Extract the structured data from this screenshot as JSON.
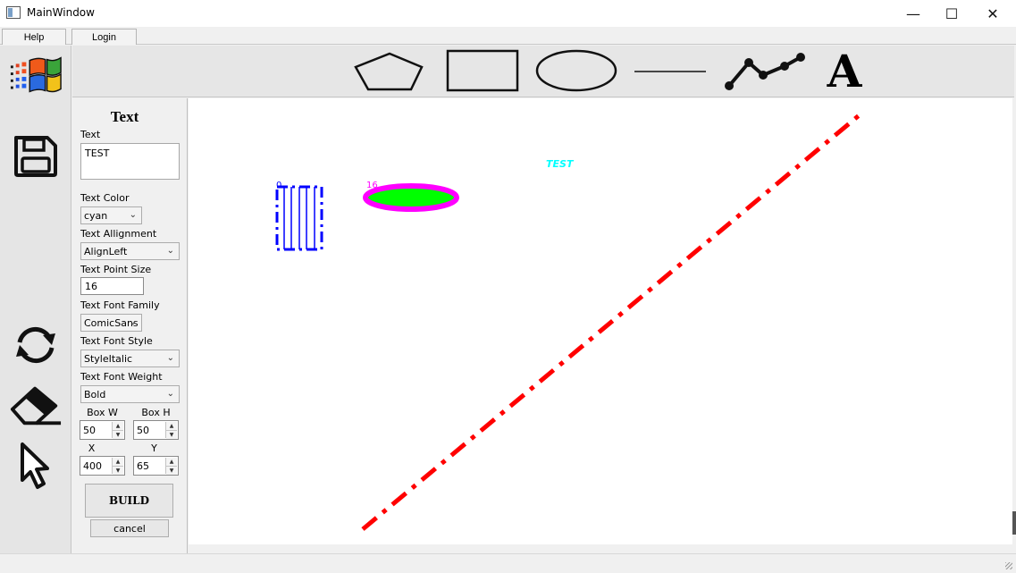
{
  "window": {
    "title": "MainWindow",
    "minimize_glyph": "—",
    "maximize_glyph": "☐",
    "close_glyph": "✕"
  },
  "menu": {
    "help": "Help",
    "login": "Login"
  },
  "left_tools": [
    {
      "icon": "windows-logo-icon"
    },
    {
      "icon": "save-icon"
    },
    {
      "icon": "refresh-icon"
    },
    {
      "icon": "eraser-icon"
    },
    {
      "icon": "pointer-icon"
    }
  ],
  "shape_tools": [
    {
      "icon": "pentagon-icon"
    },
    {
      "icon": "rectangle-icon"
    },
    {
      "icon": "ellipse-icon"
    },
    {
      "icon": "line-icon"
    },
    {
      "icon": "polyline-icon"
    },
    {
      "icon": "text-tool-icon",
      "glyph": "A"
    }
  ],
  "panel": {
    "title": "Text",
    "text_label": "Text",
    "text_value": "TEST",
    "text_color_label": "Text Color",
    "text_color_value": "cyan",
    "alignment_label": "Text Allignment",
    "alignment_value": "AlignLeft",
    "point_size_label": "Text Point Size",
    "point_size_value": "16",
    "font_family_label": "Text Font Family",
    "font_family_value": "ComicSans",
    "font_style_label": "Text Font Style",
    "font_style_value": "StyleItalic",
    "font_weight_label": "Text Font Weight",
    "font_weight_value": "Bold",
    "box_w_label": "Box W",
    "box_w_value": "50",
    "box_h_label": "Box H",
    "box_h_value": "50",
    "x_label": "X",
    "x_value": "400",
    "y_label": "Y",
    "y_value": "65",
    "build_label": "BUILD",
    "cancel_label": "cancel"
  },
  "canvas": {
    "rect_shape_id": "0",
    "ellipse_shape_id": "16",
    "text_item": "TEST",
    "colors": {
      "rect_stroke": "#0000ff",
      "ellipse_stroke": "#ff00ff",
      "ellipse_fill": "#00ff00",
      "line_stroke": "#ff0000",
      "text": "#00ffff"
    }
  }
}
